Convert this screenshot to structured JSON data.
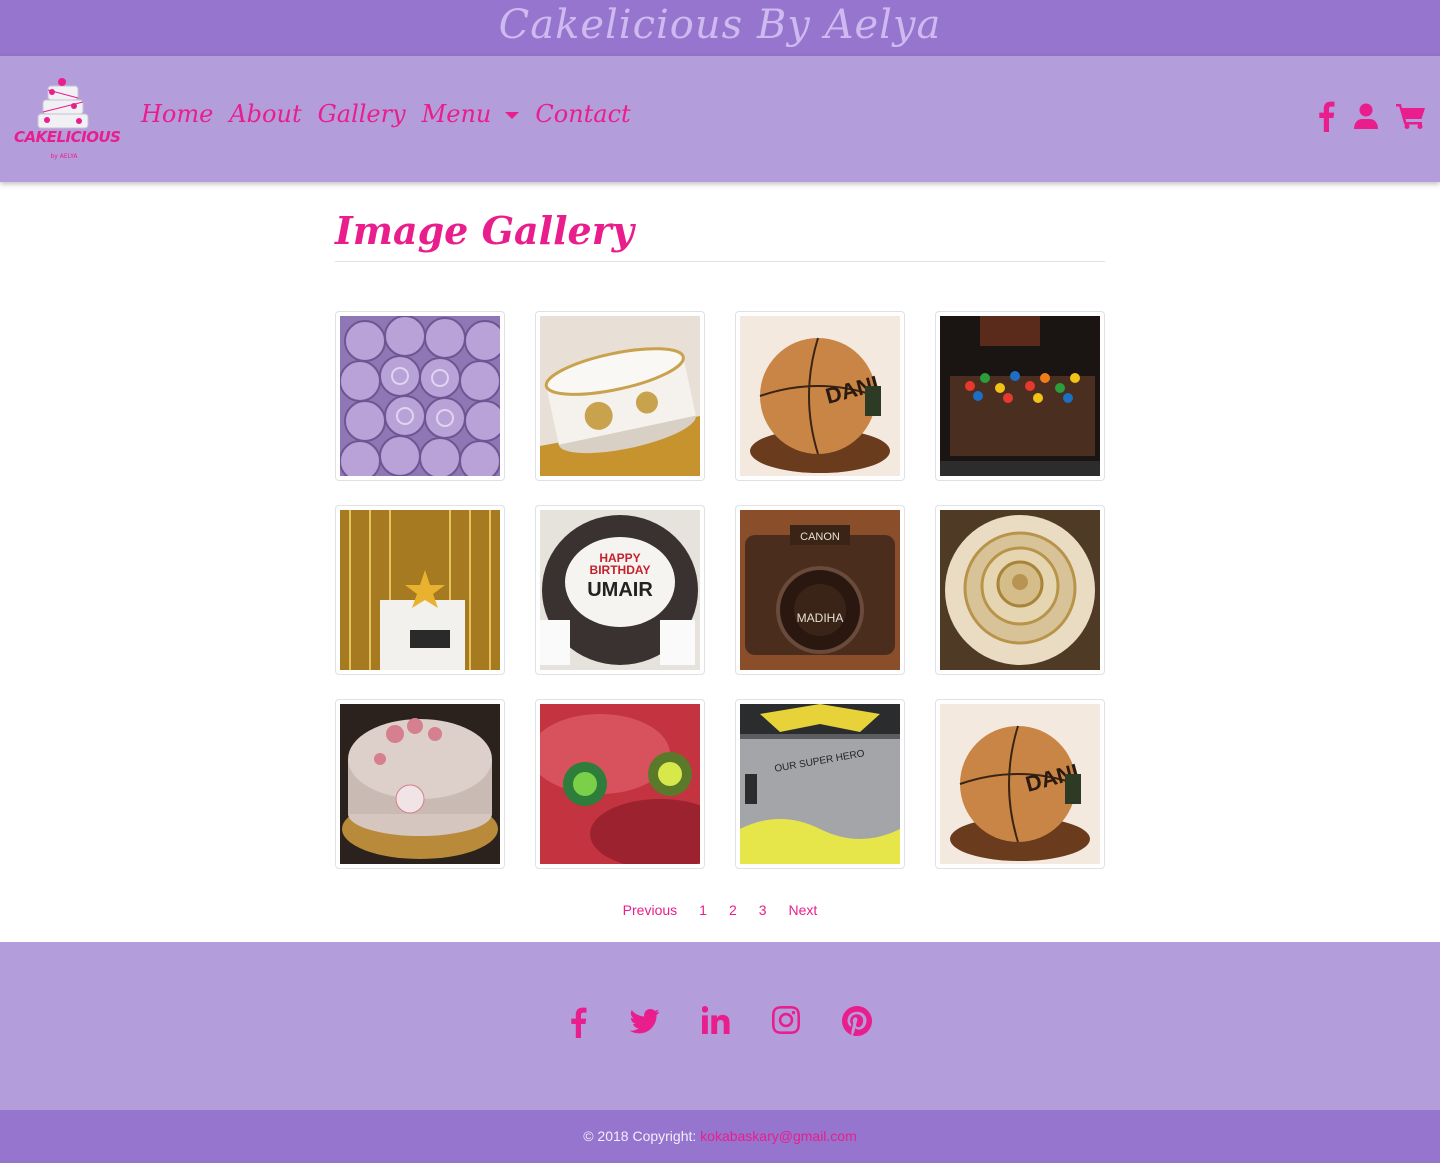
{
  "banner": {
    "title": "Cakelicious By Aelya"
  },
  "logo": {
    "text": "CAKELICIOUS",
    "sub": "by AELYA"
  },
  "nav": {
    "items": [
      "Home",
      "About",
      "Gallery",
      "Menu",
      "Contact"
    ],
    "icons": [
      "facebook-icon",
      "user-icon",
      "cart-icon"
    ]
  },
  "main": {
    "title": "Image Gallery",
    "gallery": [
      {
        "name": "lavender-rosette-cake",
        "color": "#a98cc9"
      },
      {
        "name": "white-gold-rose-cake",
        "color": "#e9e2da"
      },
      {
        "name": "basketball-cake",
        "color": "#c27b42"
      },
      {
        "name": "mm-candy-cake",
        "color": "#3b2a22"
      },
      {
        "name": "movie-star-cake",
        "color": "#b88d2c"
      },
      {
        "name": "poker-birthday-cake",
        "color": "#3d3532"
      },
      {
        "name": "camera-cake",
        "color": "#5a3622"
      },
      {
        "name": "gold-rose-cake",
        "color": "#cfb38a"
      },
      {
        "name": "pink-rose-cake",
        "color": "#b9a7a1"
      },
      {
        "name": "red-beyblade-cake",
        "color": "#c43a45"
      },
      {
        "name": "batman-cake",
        "color": "#8d8f91"
      },
      {
        "name": "basketball-cake-2",
        "color": "#c27b42"
      }
    ]
  },
  "pagination": {
    "previous": "Previous",
    "pages": [
      "1",
      "2",
      "3"
    ],
    "next": "Next"
  },
  "footer": {
    "social": [
      "facebook-icon",
      "twitter-icon",
      "linkedin-icon",
      "instagram-icon",
      "pinterest-icon"
    ],
    "copyright_prefix": "© 2018 Copyright: ",
    "email": "kokabaskary@gmail.com"
  },
  "colors": {
    "accent": "#e91e8c",
    "banner": "#9575cd",
    "nav": "#b39ddb"
  }
}
